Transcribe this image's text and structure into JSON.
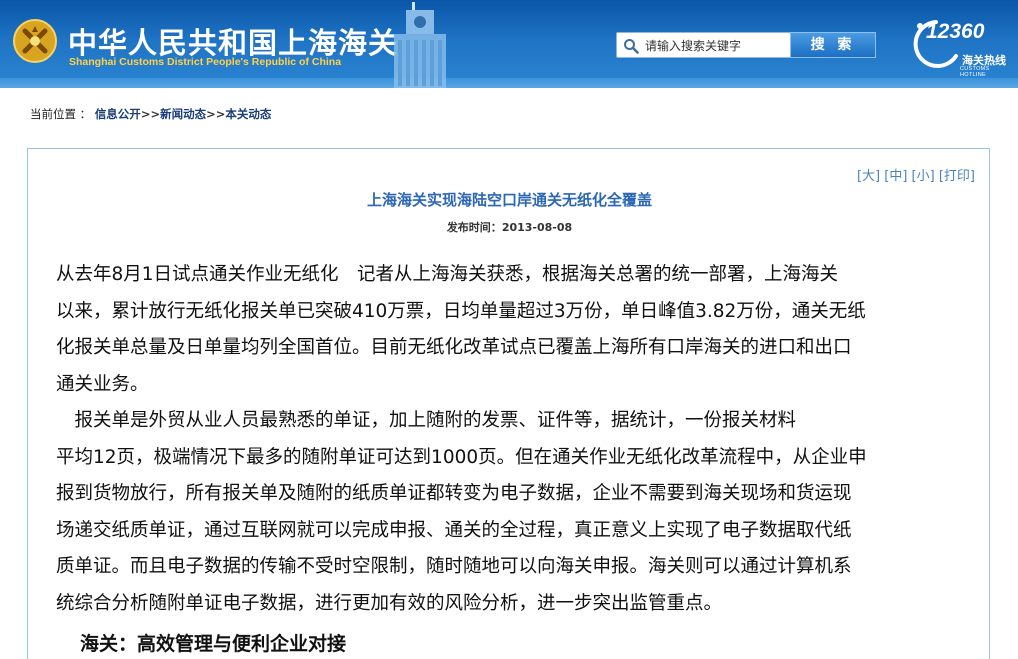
{
  "header": {
    "title": "中华人民共和国上海海关",
    "subtitle": "Shanghai Customs District People's Republic of China",
    "search": {
      "placeholder": "请输入搜索关键字",
      "button_label": "搜 索"
    },
    "hotline": {
      "number": "12360",
      "label_cn": "海关热线",
      "label_en": "CUSTOMS HOTLINE"
    },
    "icons": {
      "emblem": "customs-emblem-icon",
      "building": "customs-house-building-icon",
      "search": "search-icon"
    },
    "colors": {
      "header_bg": "#1f73c4",
      "subtitle": "#ffd24a"
    }
  },
  "breadcrumb": {
    "label": "当前位置 ：",
    "items": [
      "信息公开",
      "新闻动态",
      "本关动态"
    ],
    "separator": ">>"
  },
  "article": {
    "font_tools": [
      "[大]",
      "[中]",
      "[小]",
      "[打印]"
    ],
    "title": "上海海关实现海陆空口岸通关无纸化全覆盖",
    "date_label": "发布时间：",
    "date": "2013-08-08",
    "lines": [
      "从去年8月1日试点通关作业无纸化　记者从上海海关获悉，根据海关总署的统一部署，上海海关",
      "以来，累计放行无纸化报关单已突破410万票，日均单量超过3万份，单日峰值3.82万份，通关无纸",
      "化报关单总量及日单量均列全国首位。目前无纸化改革试点已覆盖上海所有口岸海关的进口和出口",
      "通关业务。",
      "　报关单是外贸从业人员最熟悉的单证，加上随附的发票、证件等，据统计，一份报关材料",
      "平均12页，极端情况下最多的随附单证可达到1000页。但在通关作业无纸化改革流程中，从企业申",
      "报到货物放行，所有报关单及随附的纸质单证都转变为电子数据，企业不需要到海关现场和货运现",
      "场递交纸质单证，通过互联网就可以完成申报、通关的全过程，真正意义上实现了电子数据取代纸",
      "质单证。而且电子数据的传输不受时空限制，随时随地可以向海关申报。海关则可以通过计算机系",
      "统综合分析随附单证电子数据，进行更加有效的风险分析，进一步突出监管重点。"
    ],
    "section_heading": "海关：高效管理与便利企业对接"
  }
}
